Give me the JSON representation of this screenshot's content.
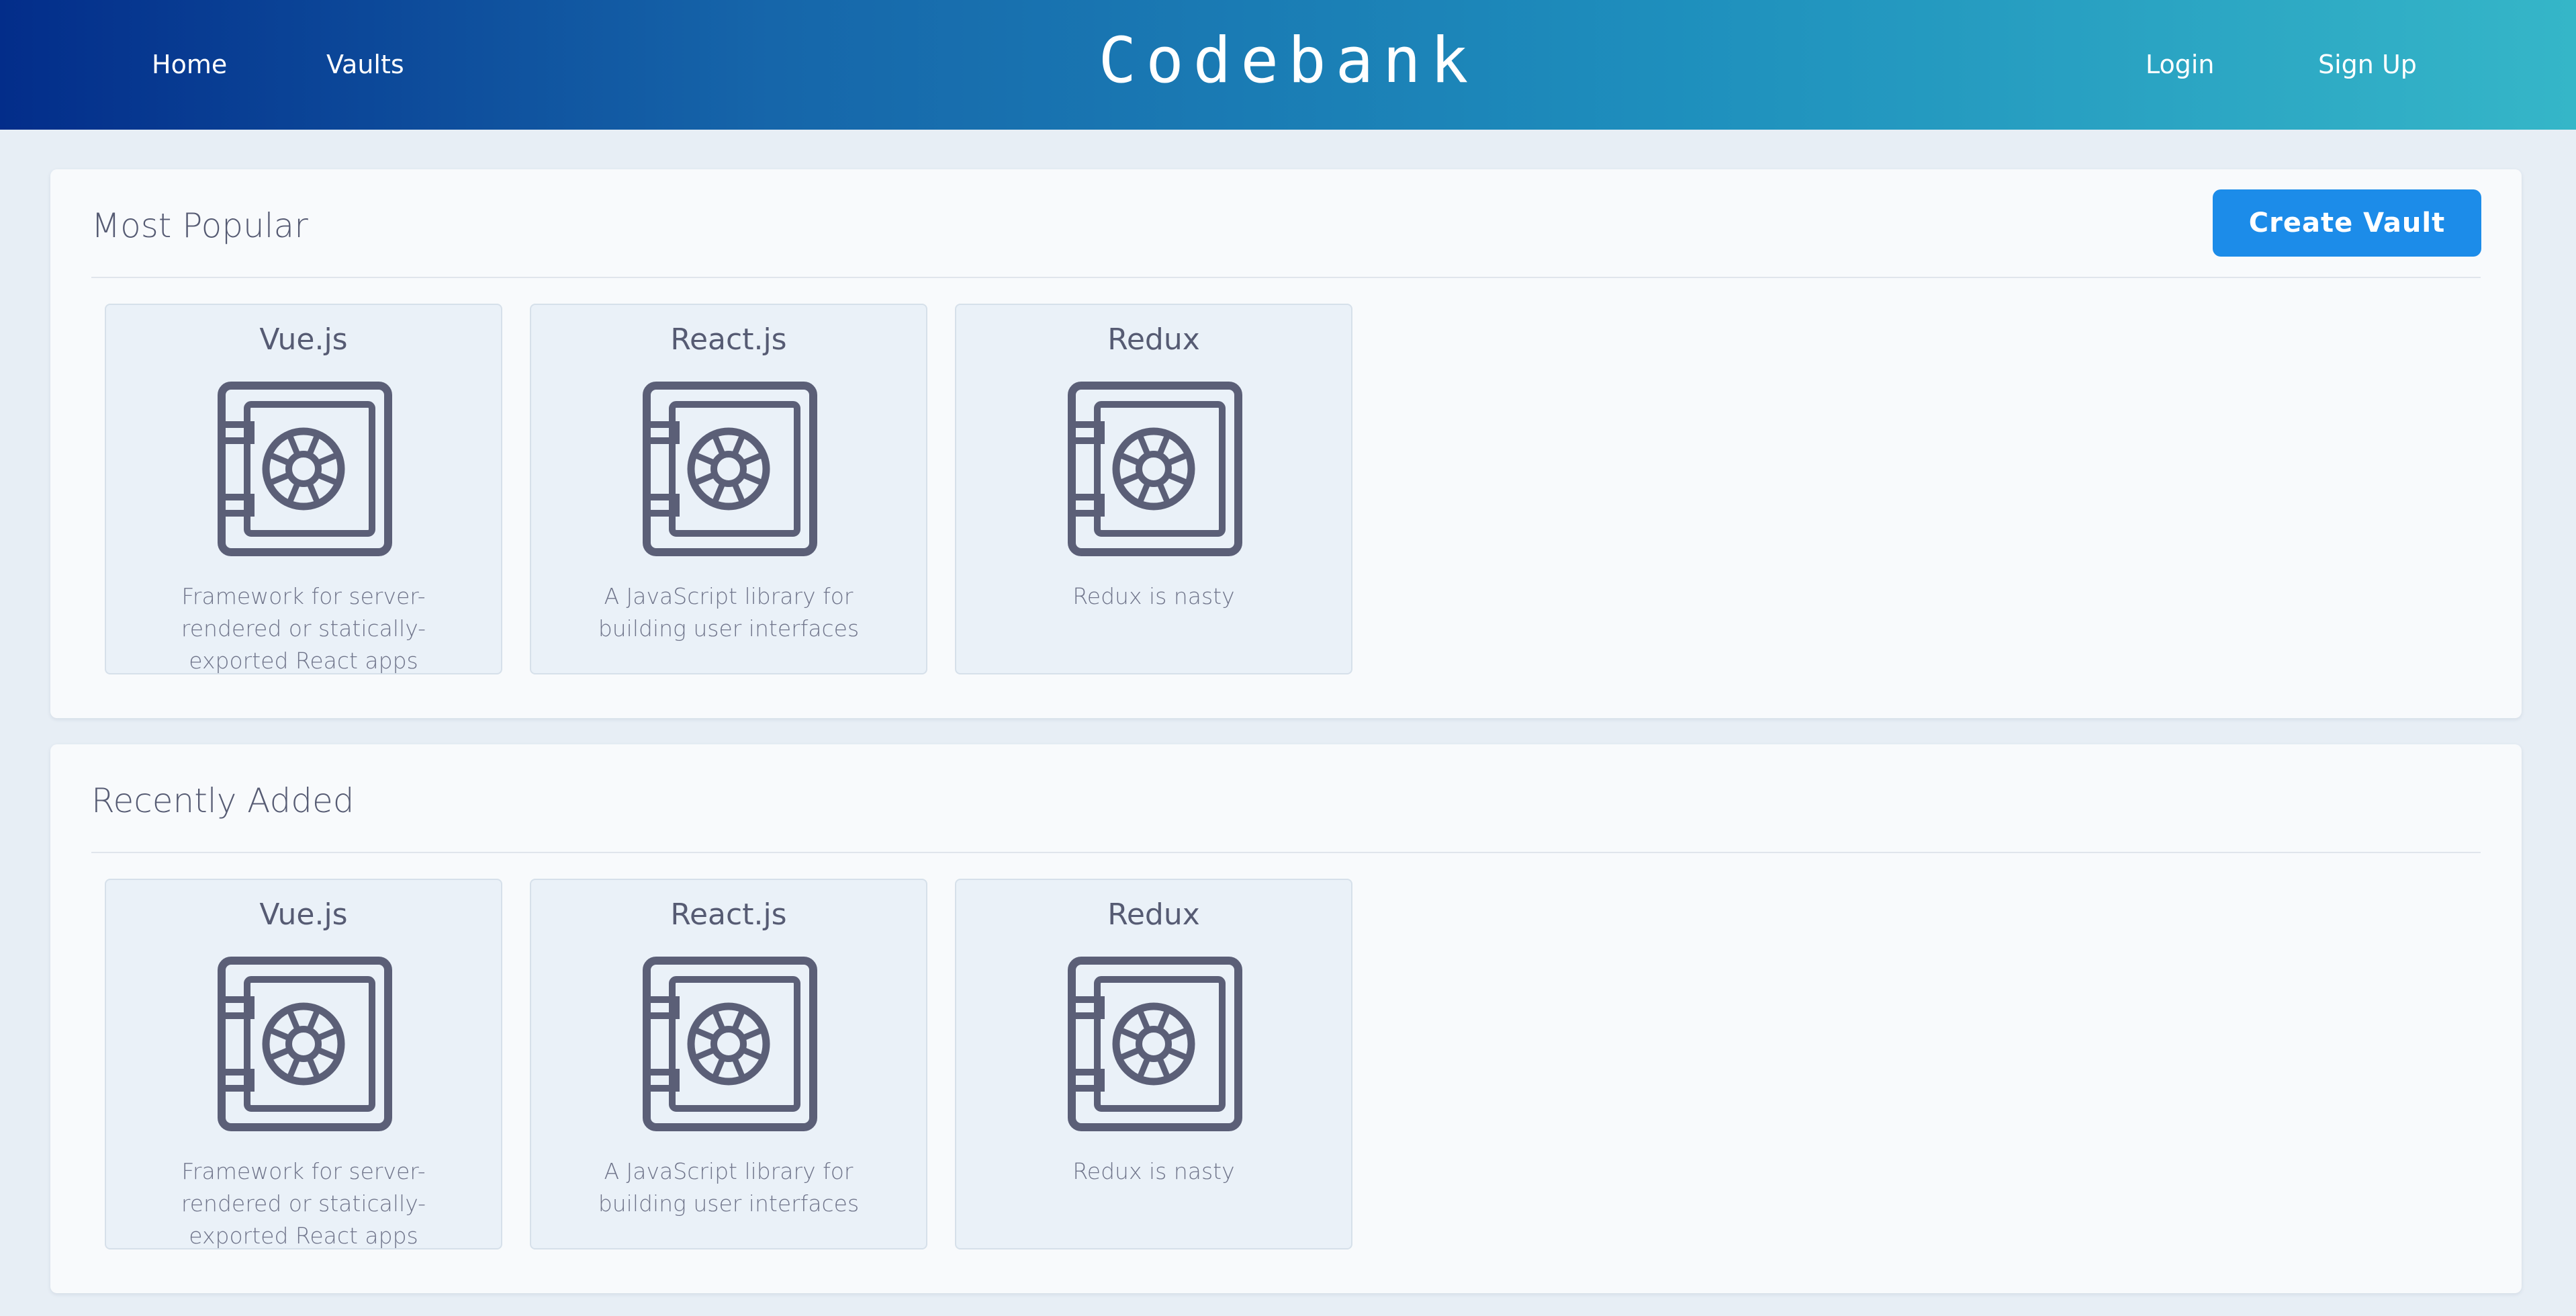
{
  "header": {
    "brand": "Codebank",
    "nav_left": [
      {
        "label": "Home"
      },
      {
        "label": "Vaults"
      }
    ],
    "nav_right": [
      {
        "label": "Login"
      },
      {
        "label": "Sign Up"
      }
    ]
  },
  "colors": {
    "header_gradient_start": "#032d8a",
    "header_gradient_end": "#35b6c8",
    "accent_button": "#1c8ce9",
    "page_background": "#e7eef5",
    "card_background": "#eaf1f8",
    "text": "#565b73"
  },
  "sections": [
    {
      "title": "Most Popular",
      "action_label": "Create Vault",
      "vaults": [
        {
          "name": "Vue.js",
          "icon": "vault-safe-icon",
          "description": "Framework for server-rendered or statically-exported React apps"
        },
        {
          "name": "React.js",
          "icon": "vault-safe-icon",
          "description": "A JavaScript library for building user interfaces"
        },
        {
          "name": "Redux",
          "icon": "vault-safe-icon",
          "description": "Redux is nasty"
        }
      ]
    },
    {
      "title": "Recently Added",
      "vaults": [
        {
          "name": "Vue.js",
          "icon": "vault-safe-icon",
          "description": "Framework for server-rendered or statically-exported React apps"
        },
        {
          "name": "React.js",
          "icon": "vault-safe-icon",
          "description": "A JavaScript library for building user interfaces"
        },
        {
          "name": "Redux",
          "icon": "vault-safe-icon",
          "description": "Redux is nasty"
        }
      ]
    }
  ]
}
